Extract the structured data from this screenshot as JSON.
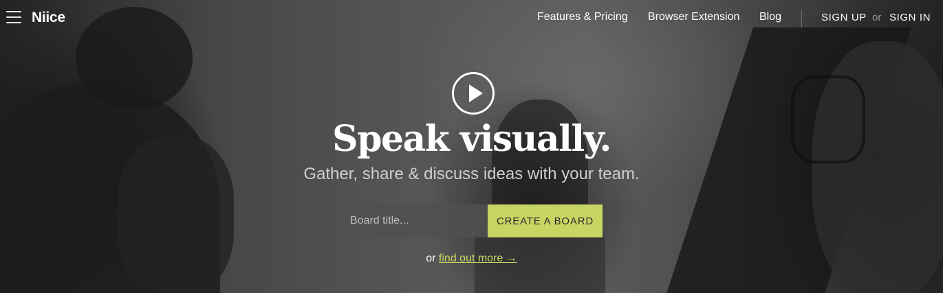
{
  "nav": {
    "logo": "Niice",
    "links": [
      "Features & Pricing",
      "Browser Extension",
      "Blog"
    ],
    "sign_up": "SIGN UP",
    "or": "or",
    "sign_in": "SIGN IN"
  },
  "hero": {
    "headline": "Speak visually.",
    "subheadline": "Gather, share & discuss ideas with your team.",
    "board_input_placeholder": "Board title...",
    "create_button": "CREATE A BOARD",
    "find_out_prefix": "or",
    "find_out_link": "find out more →"
  },
  "colors": {
    "accent": "#c9d563"
  },
  "icons": {
    "menu": "hamburger-menu-icon",
    "play": "play-icon"
  }
}
